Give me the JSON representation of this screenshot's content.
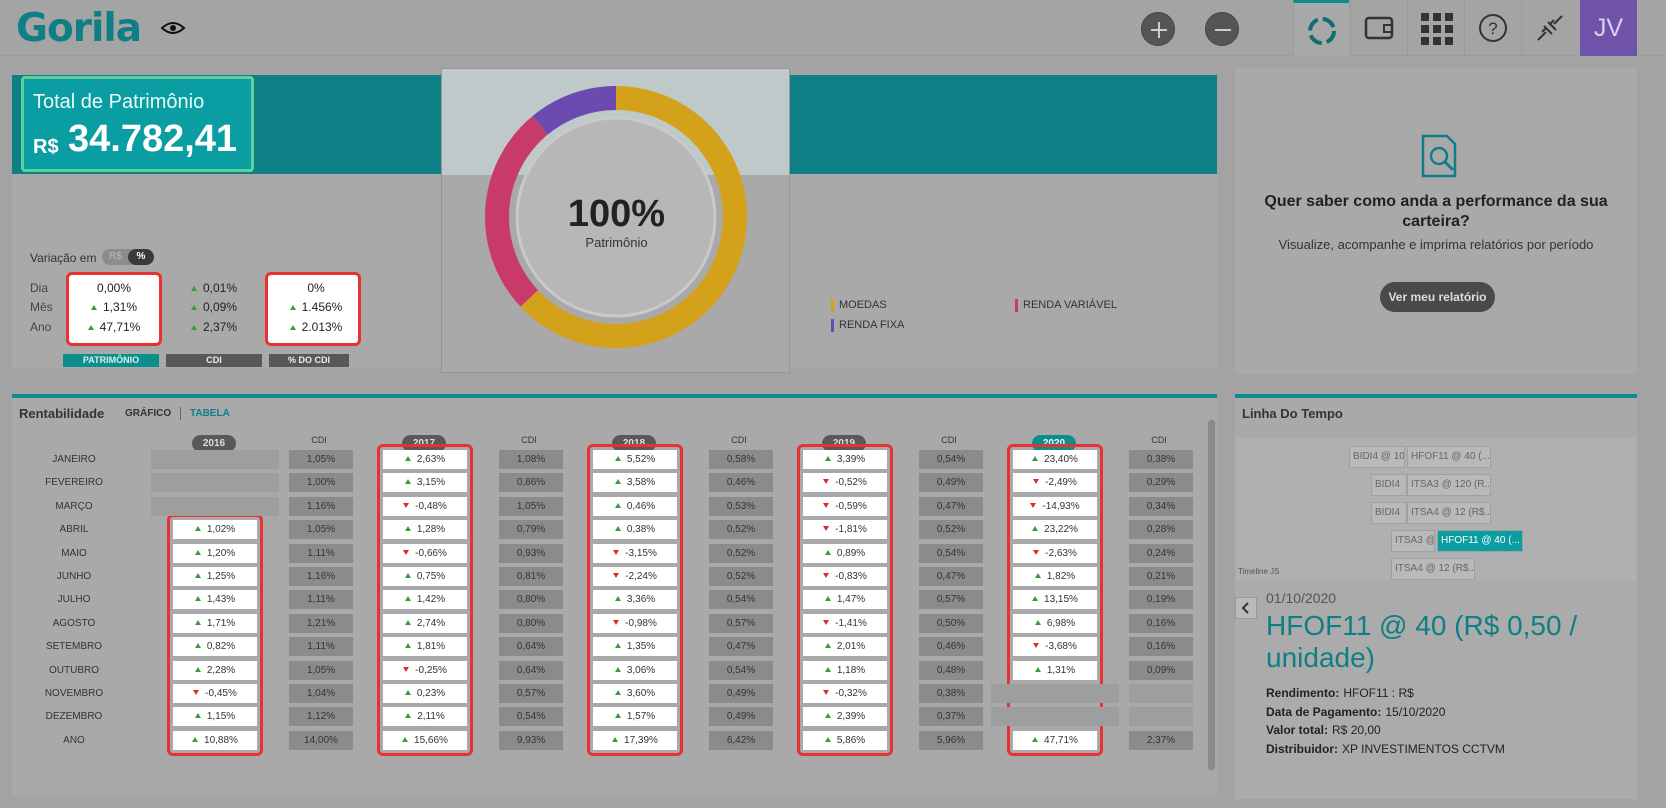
{
  "brand": {
    "logo": "Gorila"
  },
  "topbar": {
    "icons": [
      "eye-icon",
      "plus-icon",
      "minus-icon",
      "refresh-icon",
      "wallet-icon",
      "apps-grid-icon",
      "help-icon",
      "plug-icon"
    ],
    "avatar": "JV"
  },
  "total": {
    "label": "Total de Patrimônio",
    "currency": "R$",
    "value": "34.782,41"
  },
  "variacao": {
    "label": "Variação em",
    "toggle": [
      "R$",
      "%"
    ],
    "rows": [
      "Dia",
      "Mês",
      "Ano"
    ],
    "patrimonio": [
      {
        "v": "0,00%",
        "dir": "none"
      },
      {
        "v": "1,31%",
        "dir": "up"
      },
      {
        "v": "47,71%",
        "dir": "up"
      }
    ],
    "cdi": [
      {
        "v": "0,01%",
        "dir": "up"
      },
      {
        "v": "0,09%",
        "dir": "up"
      },
      {
        "v": "2,37%",
        "dir": "up"
      }
    ],
    "pct_cdi": [
      {
        "v": "0%",
        "dir": "none"
      },
      {
        "v": "1.456%",
        "dir": "up"
      },
      {
        "v": "2.013%",
        "dir": "up"
      }
    ],
    "tags": [
      "PATRIMÔNIO",
      "CDI",
      "% DO CDI"
    ]
  },
  "donut": {
    "value": "100%",
    "label": "Patrimônio",
    "segments": [
      {
        "name": "MOEDAS",
        "pct": 63,
        "color": "#d4a21a"
      },
      {
        "name": "RENDA VARIÁVEL",
        "pct": 26,
        "color": "#c83a6a"
      },
      {
        "name": "RENDA FIXA",
        "pct": 11,
        "color": "#6b4bb0"
      }
    ]
  },
  "report": {
    "title": "Quer saber como anda a performance da sua carteira?",
    "subtitle": "Visualize, acompanhe e imprima relatórios por período",
    "button": "Ver meu relatório"
  },
  "rentabilidade": {
    "title": "Rentabilidade",
    "tabs": [
      "GRÁFICO",
      "TABELA"
    ],
    "months": [
      "JANEIRO",
      "FEVEREIRO",
      "MARÇO",
      "ABRIL",
      "MAIO",
      "JUNHO",
      "JULHO",
      "AGOSTO",
      "SETEMBRO",
      "OUTUBRO",
      "NOVEMBRO",
      "DEZEMBRO",
      "ANO"
    ],
    "cdi_label": "CDI",
    "years": [
      {
        "year": "2016",
        "values": [
          "",
          "",
          "",
          "1,02%",
          "1,20%",
          "1,25%",
          "1,43%",
          "1,71%",
          "0,82%",
          "2,28%",
          "-0,45%",
          "1,15%",
          "10,88%"
        ],
        "dirs": [
          "",
          "",
          "",
          "up",
          "up",
          "up",
          "up",
          "up",
          "up",
          "up",
          "dn",
          "up",
          "up"
        ],
        "cdi": [
          "1,05%",
          "1,00%",
          "1,16%",
          "1,05%",
          "1,11%",
          "1,16%",
          "1,11%",
          "1,21%",
          "1,11%",
          "1,05%",
          "1,04%",
          "1,12%",
          "14,00%"
        ]
      },
      {
        "year": "2017",
        "values": [
          "2,63%",
          "3,15%",
          "-0,48%",
          "1,28%",
          "-0,66%",
          "0,75%",
          "1,42%",
          "2,74%",
          "1,81%",
          "-0,25%",
          "0,23%",
          "2,11%",
          "15,66%"
        ],
        "dirs": [
          "up",
          "up",
          "dn",
          "up",
          "dn",
          "up",
          "up",
          "up",
          "up",
          "dn",
          "up",
          "up",
          "up"
        ],
        "cdi": [
          "1,08%",
          "0,86%",
          "1,05%",
          "0,79%",
          "0,93%",
          "0,81%",
          "0,80%",
          "0,80%",
          "0,64%",
          "0,64%",
          "0,57%",
          "0,54%",
          "9,93%"
        ]
      },
      {
        "year": "2018",
        "values": [
          "5,52%",
          "3,58%",
          "0,46%",
          "0,38%",
          "-3,15%",
          "-2,24%",
          "3,36%",
          "-0,98%",
          "1,35%",
          "3,06%",
          "3,60%",
          "1,57%",
          "17,39%"
        ],
        "dirs": [
          "up",
          "up",
          "up",
          "up",
          "dn",
          "dn",
          "up",
          "dn",
          "up",
          "up",
          "up",
          "up",
          "up"
        ],
        "cdi": [
          "0,58%",
          "0,46%",
          "0,53%",
          "0,52%",
          "0,52%",
          "0,52%",
          "0,54%",
          "0,57%",
          "0,47%",
          "0,54%",
          "0,49%",
          "0,49%",
          "6,42%"
        ]
      },
      {
        "year": "2019",
        "values": [
          "3,39%",
          "-0,52%",
          "-0,59%",
          "-1,81%",
          "0,89%",
          "-0,83%",
          "1,47%",
          "-1,41%",
          "2,01%",
          "1,18%",
          "-0,32%",
          "2,39%",
          "5,86%"
        ],
        "dirs": [
          "up",
          "dn",
          "dn",
          "dn",
          "up",
          "dn",
          "up",
          "dn",
          "up",
          "up",
          "dn",
          "up",
          "up"
        ],
        "cdi": [
          "0,54%",
          "0,49%",
          "0,47%",
          "0,52%",
          "0,54%",
          "0,47%",
          "0,57%",
          "0,50%",
          "0,46%",
          "0,48%",
          "0,38%",
          "0,37%",
          "5,96%"
        ]
      },
      {
        "year": "2020",
        "values": [
          "23,40%",
          "-2,49%",
          "-14,93%",
          "23,22%",
          "-2,63%",
          "1,82%",
          "13,15%",
          "6,98%",
          "-3,68%",
          "1,31%",
          "",
          "",
          "47,71%"
        ],
        "dirs": [
          "up",
          "dn",
          "dn",
          "up",
          "dn",
          "up",
          "up",
          "up",
          "dn",
          "up",
          "",
          "",
          "up"
        ],
        "cdi": [
          "0,38%",
          "0,29%",
          "0,34%",
          "0,28%",
          "0,24%",
          "0,21%",
          "0,19%",
          "0,16%",
          "0,16%",
          "0,09%",
          "",
          "",
          "2,37%"
        ]
      }
    ]
  },
  "timeline": {
    "title": "Linha Do Tempo",
    "items": [
      "BIDI4 @ 10",
      "HFOF11 @ 40 (...",
      "BIDI4",
      "ITSA3 @ 120 (R...",
      "BIDI4",
      "ITSA4 @ 12 (R$...",
      "ITSA3 @",
      "HFOF11 @ 40 (...",
      "ITSA4 @ 12 (R$..."
    ],
    "watermark": "Timeline JS",
    "date": "01/10/2020",
    "headline": "HFOF11 @ 40 (R$ 0,50 / unidade)",
    "details": [
      {
        "k": "Rendimento:",
        "v": "HFOF11 : R$"
      },
      {
        "k": "Data de Pagamento:",
        "v": "15/10/2020"
      },
      {
        "k": "Valor total:",
        "v": "R$ 20,00"
      },
      {
        "k": "Distribuidor:",
        "v": "XP INVESTIMENTOS CCTVM"
      }
    ]
  }
}
